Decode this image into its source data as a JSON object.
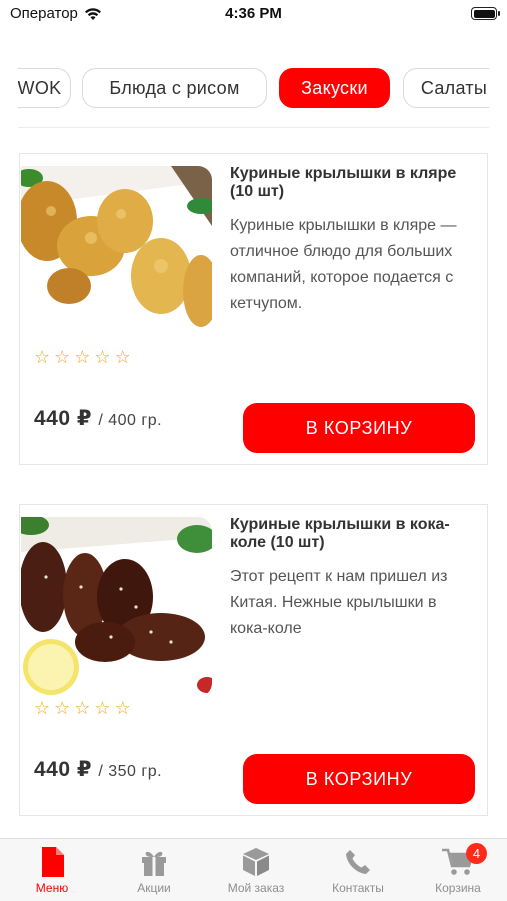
{
  "status_bar": {
    "carrier": "Оператор",
    "time": "4:36 PM"
  },
  "categories": [
    {
      "label": "WOK",
      "active": false
    },
    {
      "label": "Блюда с рисом",
      "active": false
    },
    {
      "label": "Закуски",
      "active": true
    },
    {
      "label": "Салаты",
      "active": false
    }
  ],
  "products": [
    {
      "title": "Куриные крылышки в кляре (10 шт)",
      "description": "Куриные крылышки в кляре — отличное блюдо для больших компаний, которое подается с кетчупом.",
      "rating": 0,
      "price": "440 ₽",
      "weight": "/ 400 гр.",
      "button": "В КОРЗИНУ",
      "image": "fried-chicken-wings-photo"
    },
    {
      "title": "Куриные крылышки в кока-коле (10 шт)",
      "description": "Этот рецепт к нам пришел из Китая. Нежные крылышки в кока-коле",
      "rating": 0,
      "price": "440 ₽",
      "weight": "/ 350 гр.",
      "button": "В КОРЗИНУ",
      "image": "glazed-chicken-wings-photo"
    }
  ],
  "tabbar": {
    "items": [
      {
        "label": "Меню",
        "icon": "menu-document-icon",
        "active": true
      },
      {
        "label": "Акции",
        "icon": "gift-icon",
        "active": false
      },
      {
        "label": "Мой заказ",
        "icon": "box-icon",
        "active": false
      },
      {
        "label": "Контакты",
        "icon": "phone-icon",
        "active": false
      },
      {
        "label": "Корзина",
        "icon": "cart-icon",
        "active": false
      }
    ],
    "cart_badge": "4"
  },
  "colors": {
    "accent": "#ff0000",
    "star": "#f5a623",
    "inactive": "#8e8e8e"
  }
}
